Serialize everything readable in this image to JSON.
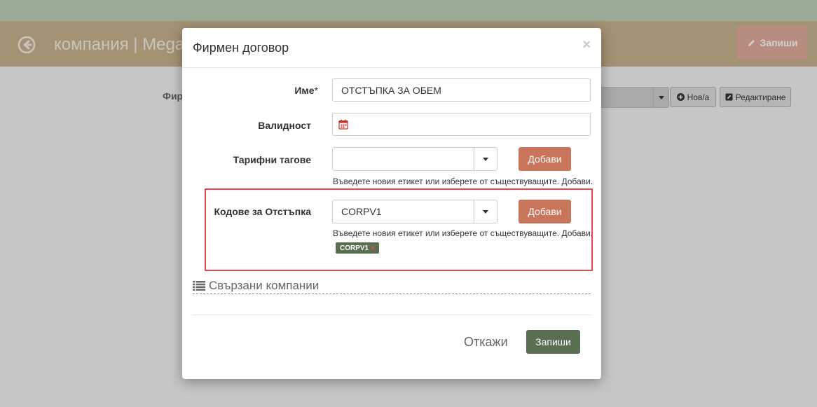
{
  "background": {
    "page_title": "компания | Mega",
    "save_button_label": "Запиши",
    "field_label": "Фир",
    "new_button_label": "Нов/а",
    "edit_button_label": "Редактиране"
  },
  "modal": {
    "title": "Фирмен договор",
    "close_symbol": "×",
    "name": {
      "label": "Име",
      "required_marker": "*",
      "value": "ОТСТЪПКА ЗА ОБЕМ"
    },
    "validity": {
      "label": "Валидност",
      "value": ""
    },
    "tariff_tags": {
      "label": "Тарифни тагове",
      "value": "",
      "add_label": "Добави",
      "help": "Въведете новия етикет или изберете от съществуващите. Добави."
    },
    "discount_codes": {
      "label": "Кодове за Отстъпка",
      "value": "CORPV1",
      "add_label": "Добави",
      "help": "Въведете новия етикет или изберете от съществуващите. Добави.",
      "tags": [
        {
          "label": "CORPV1",
          "remove_symbol": "×"
        }
      ]
    },
    "linked_companies": {
      "title": "Свързани компании"
    },
    "footer": {
      "cancel_label": "Откажи",
      "save_label": "Запиши"
    }
  },
  "colors": {
    "top_strip": "#bed0b6",
    "header": "#c8b38f",
    "add_button": "#c9755b",
    "primary_button": "#5a6e52",
    "highlight": "#e8474f"
  },
  "icons": {
    "back": "arrow-circle-left-icon",
    "pencil": "pencil-icon",
    "plus": "plus-circle-icon",
    "edit": "edit-icon",
    "calendar": "calendar-icon",
    "caret": "caret-down-icon",
    "list": "list-icon"
  }
}
